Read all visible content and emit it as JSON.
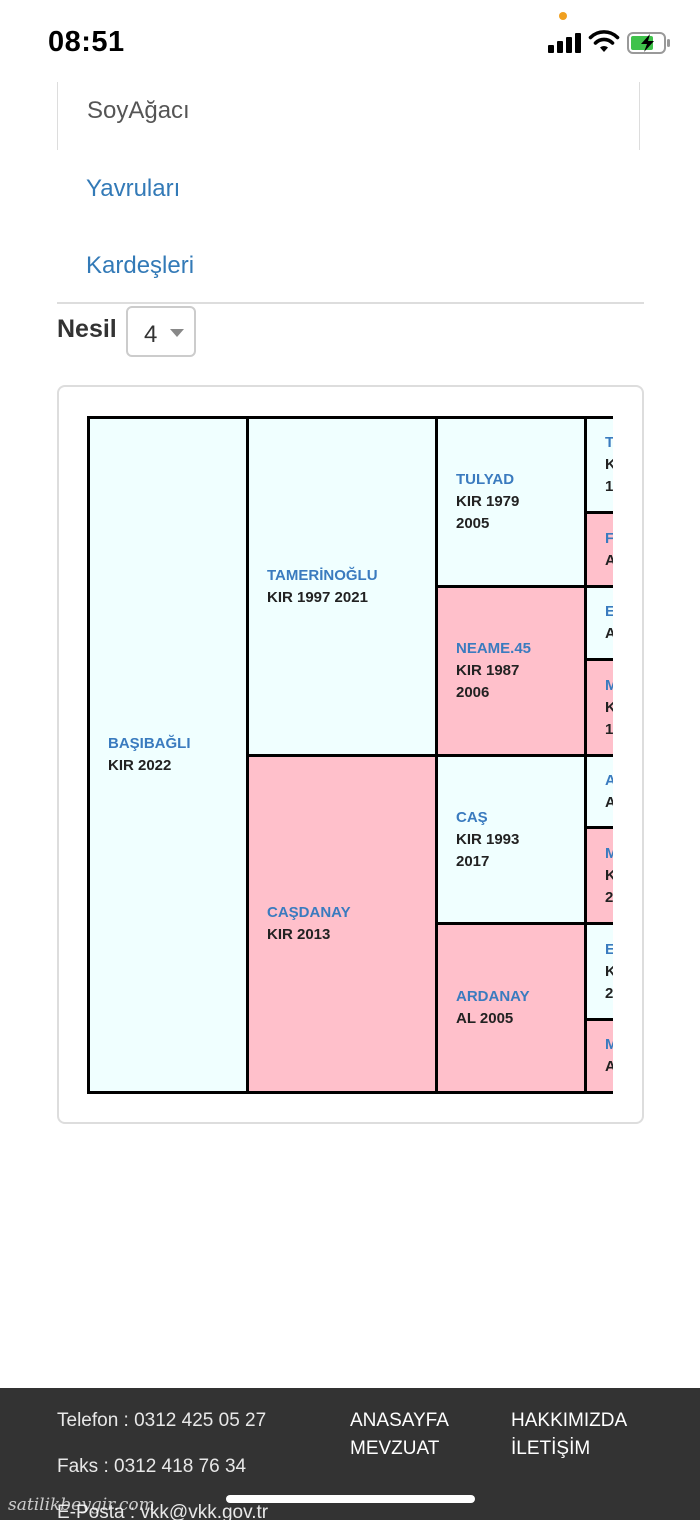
{
  "status_bar": {
    "time": "08:51",
    "icons": [
      "signal-icon",
      "wifi-icon",
      "battery-charging-icon"
    ],
    "battery_color": "#3fc24b",
    "dot_color": "#f0a020"
  },
  "tabs": {
    "active": "SoyAğacı",
    "links": [
      "Yavruları",
      "Kardeşleri"
    ],
    "link_color": "#337ab7"
  },
  "generation": {
    "label": "Nesil",
    "value": "4"
  },
  "pedigree": {
    "male_color": "#f0ffff",
    "female_color": "#ffc0cb",
    "gen1": [
      {
        "name": "BAŞIBAĞLI",
        "info": "KIR 2022",
        "sex": "male"
      }
    ],
    "gen2": [
      {
        "name": "TAMERİNOĞLU",
        "info": "KIR 1997 2021",
        "sex": "male"
      },
      {
        "name": "CAŞDANAY",
        "info": "KIR 2013",
        "sex": "female"
      }
    ],
    "gen3": [
      {
        "name": "TULYAD",
        "info": "KIR 1979",
        "info2": "2005",
        "sex": "male"
      },
      {
        "name": "NEAME.45",
        "info": "KIR 1987",
        "info2": "2006",
        "sex": "female"
      },
      {
        "name": "CAŞ",
        "info": "KIR 1993",
        "info2": "2017",
        "sex": "male"
      },
      {
        "name": "ARDANAY",
        "info": "AL 2005",
        "sex": "female"
      }
    ],
    "gen4": [
      {
        "name": "T",
        "info": "K",
        "info2": "1",
        "sex": "male"
      },
      {
        "name": "F",
        "info": "A",
        "sex": "female"
      },
      {
        "name": "E",
        "info": "A",
        "sex": "male"
      },
      {
        "name": "M",
        "info": "K",
        "info2": "1",
        "sex": "female"
      },
      {
        "name": "A",
        "info": "A",
        "sex": "male"
      },
      {
        "name": "M",
        "info": "K",
        "info2": "2",
        "sex": "female"
      },
      {
        "name": "E",
        "info": "K",
        "info2": "2",
        "sex": "male"
      },
      {
        "name": "M",
        "info": "A",
        "sex": "female"
      }
    ]
  },
  "footer": {
    "phone": "Telefon : 0312 425 05 27",
    "fax": "Faks : 0312 418 76 34",
    "email": "E-Posta : vkk@vkk.gov.tr",
    "links_col1": [
      "ANASAYFA",
      "MEVZUAT"
    ],
    "links_col2": [
      "HAKKIMIZDA",
      "İLETİŞİM"
    ],
    "watermark": "satilikbeygir.com"
  }
}
